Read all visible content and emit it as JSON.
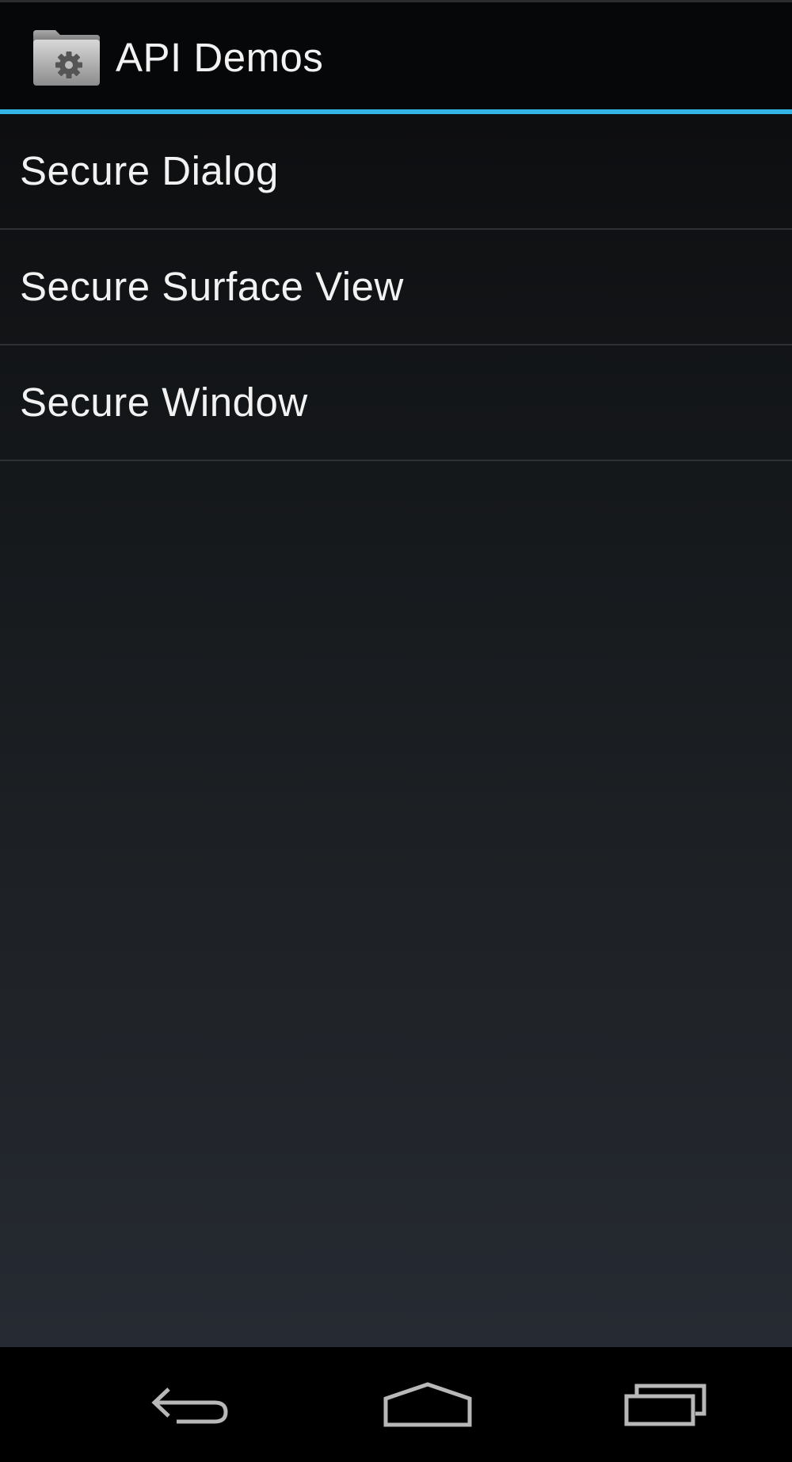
{
  "action_bar": {
    "title": "API Demos",
    "icon": "folder-gear-icon"
  },
  "list": {
    "items": [
      {
        "label": "Secure Dialog"
      },
      {
        "label": "Secure Surface View"
      },
      {
        "label": "Secure Window"
      }
    ]
  },
  "nav_bar": {
    "back_icon": "back-arrow-icon",
    "home_icon": "home-icon",
    "recents_icon": "recent-apps-icon"
  },
  "colors": {
    "accent": "#33b5e5",
    "action_bar_bg": "#060708",
    "text": "#f2f2f2",
    "divider": "#2e3134",
    "nav_bar_bg": "#000000"
  }
}
